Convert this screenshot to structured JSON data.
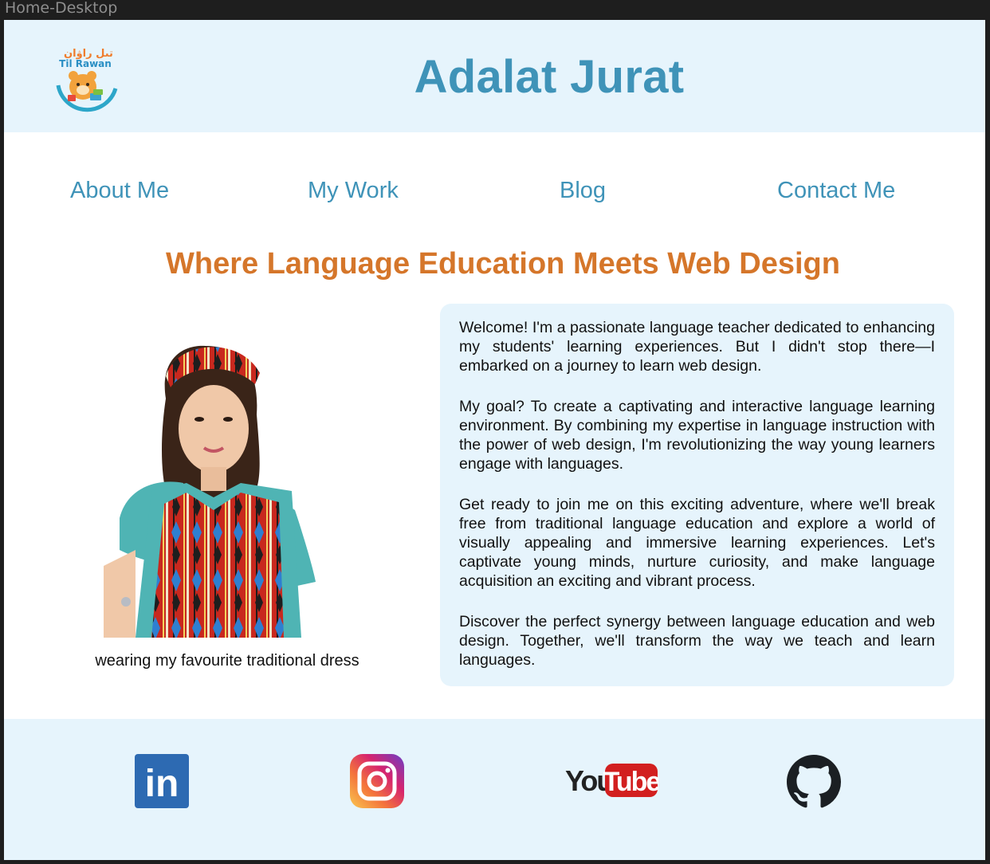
{
  "window": {
    "title": "Home-Desktop"
  },
  "header": {
    "logo": {
      "icon": "til-rawan-logo-icon",
      "text_native": "تىل راۋان",
      "text_latin": "Til Rawan"
    },
    "title": "Adalat Jurat"
  },
  "nav": {
    "items": [
      {
        "label": "About Me"
      },
      {
        "label": "My Work"
      },
      {
        "label": "Blog"
      },
      {
        "label": "Contact Me"
      }
    ]
  },
  "main": {
    "headline": "Where Language Education Meets Web Design",
    "photo": {
      "caption": "wearing my favourite traditional dress"
    },
    "paragraphs": [
      "Welcome! I'm a passionate language teacher dedicated to enhancing my students' learning experiences. But I didn't stop there—I embarked on a journey to learn web design.",
      "My goal? To create a captivating and interactive language learning environment. By combining my expertise in language instruction with the power of web design, I'm revolutionizing the way young learners engage with languages.",
      "Get ready to join me on this exciting adventure, where we'll break free from traditional language education and explore a world of visually appealing and immersive learning experiences. Let's captivate young minds, nurture curiosity, and make language acquisition an exciting and vibrant process.",
      "Discover the perfect synergy between language education and web design. Together, we'll transform the way we teach and learn languages."
    ]
  },
  "footer": {
    "social": [
      {
        "icon": "linkedin-icon",
        "text": "in"
      },
      {
        "icon": "instagram-icon"
      },
      {
        "icon": "youtube-icon",
        "text_you": "You",
        "text_tube": "Tube"
      },
      {
        "icon": "github-icon"
      }
    ]
  },
  "colors": {
    "accent_blue": "#3f93b8",
    "headline_orange": "#d5762a",
    "panel_bg": "#e6f4fc"
  }
}
